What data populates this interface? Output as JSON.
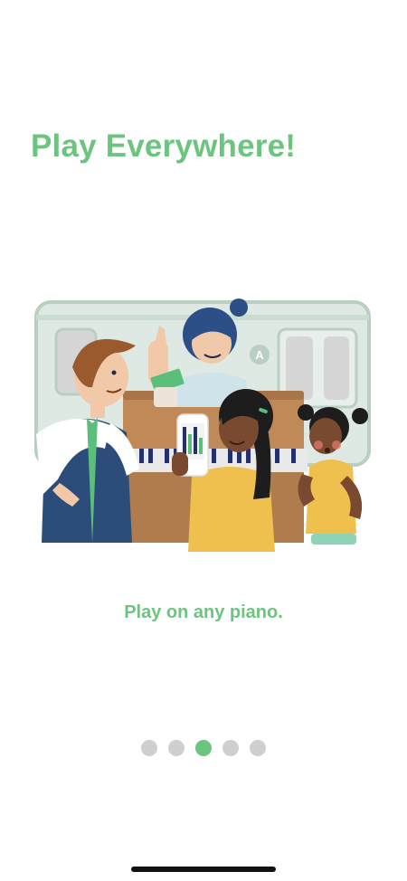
{
  "onboarding": {
    "title": "Play Everywhere!",
    "caption": "Play on any piano.",
    "page_count": 5,
    "current_page": 3,
    "subway_sign": "A",
    "colors": {
      "accent": "#6cc57f",
      "dot_inactive": "#cfcfcf",
      "background": "#ffffff"
    }
  }
}
